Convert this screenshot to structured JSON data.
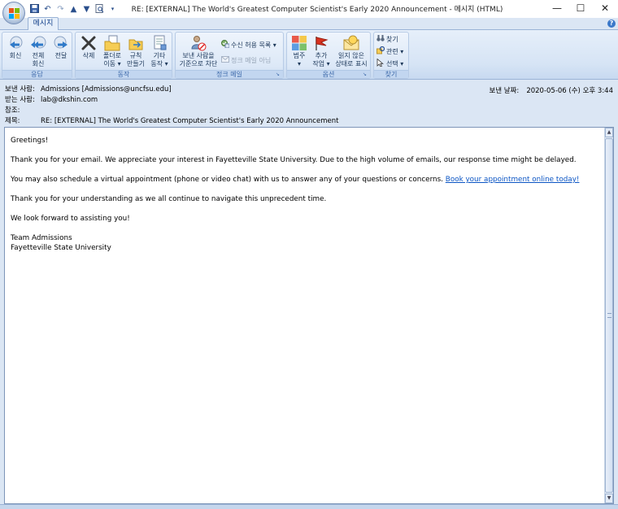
{
  "window": {
    "title": "RE: [EXTERNAL] The World's Greatest Computer Scientist's Early 2020 Announcement - 메시지 (HTML)",
    "minimize": "—",
    "maximize": "☐",
    "close": "✕"
  },
  "tabs": {
    "message": "메시지"
  },
  "ribbon": {
    "respond": {
      "label": "응답",
      "reply": "회신",
      "reply_all_1": "전체",
      "reply_all_2": "회신",
      "forward": "전달"
    },
    "actions": {
      "label": "동작",
      "delete": "삭제",
      "move_1": "폴더로",
      "move_2": "이동",
      "rules_1": "규칙",
      "rules_2": "만들기",
      "other_1": "기타",
      "other_2": "동작"
    },
    "junk": {
      "label": "정크 메일",
      "block_1": "보낸 사람을",
      "block_2": "기준으로 차단",
      "safe_list": "수신 허용 목록",
      "not_junk": "정크 메일 아님"
    },
    "options": {
      "label": "옵션",
      "categorize": "범주",
      "follow_1": "추가",
      "follow_2": "작업",
      "unread_1": "읽지 않은",
      "unread_2": "상태로 표시"
    },
    "find": {
      "label": "찾기",
      "find": "찾기",
      "related": "관련",
      "select": "선택"
    }
  },
  "header": {
    "from_label": "보낸 사람:",
    "from_value": "Admissions [Admissions@uncfsu.edu]",
    "to_label": "받는 사람:",
    "to_value": "lab@dkshin.com",
    "cc_label": "참조:",
    "cc_value": "",
    "subject_label": "제목:",
    "subject_value": "RE: [EXTERNAL] The World's Greatest Computer Scientist's Early 2020 Announcement",
    "sent_label": "보낸 날짜:",
    "sent_value": "2020-05-06 (수) 오후 3:44"
  },
  "body": {
    "greeting": "Greetings!",
    "p1": "Thank you for your email. We appreciate your interest in Fayetteville State University. Due to the high volume of emails, our response time might be delayed.",
    "p2": "You may also schedule a virtual appointment (phone or video chat) with us to answer any of your questions or concerns.",
    "p2_link": "Book your appointment online today!",
    "p3": "Thank you for your understanding as we all continue to navigate this unprecedent time.",
    "p4": "We look forward to assisting you!",
    "sig1": "Team Admissions",
    "sig2": "Fayetteville State University"
  }
}
